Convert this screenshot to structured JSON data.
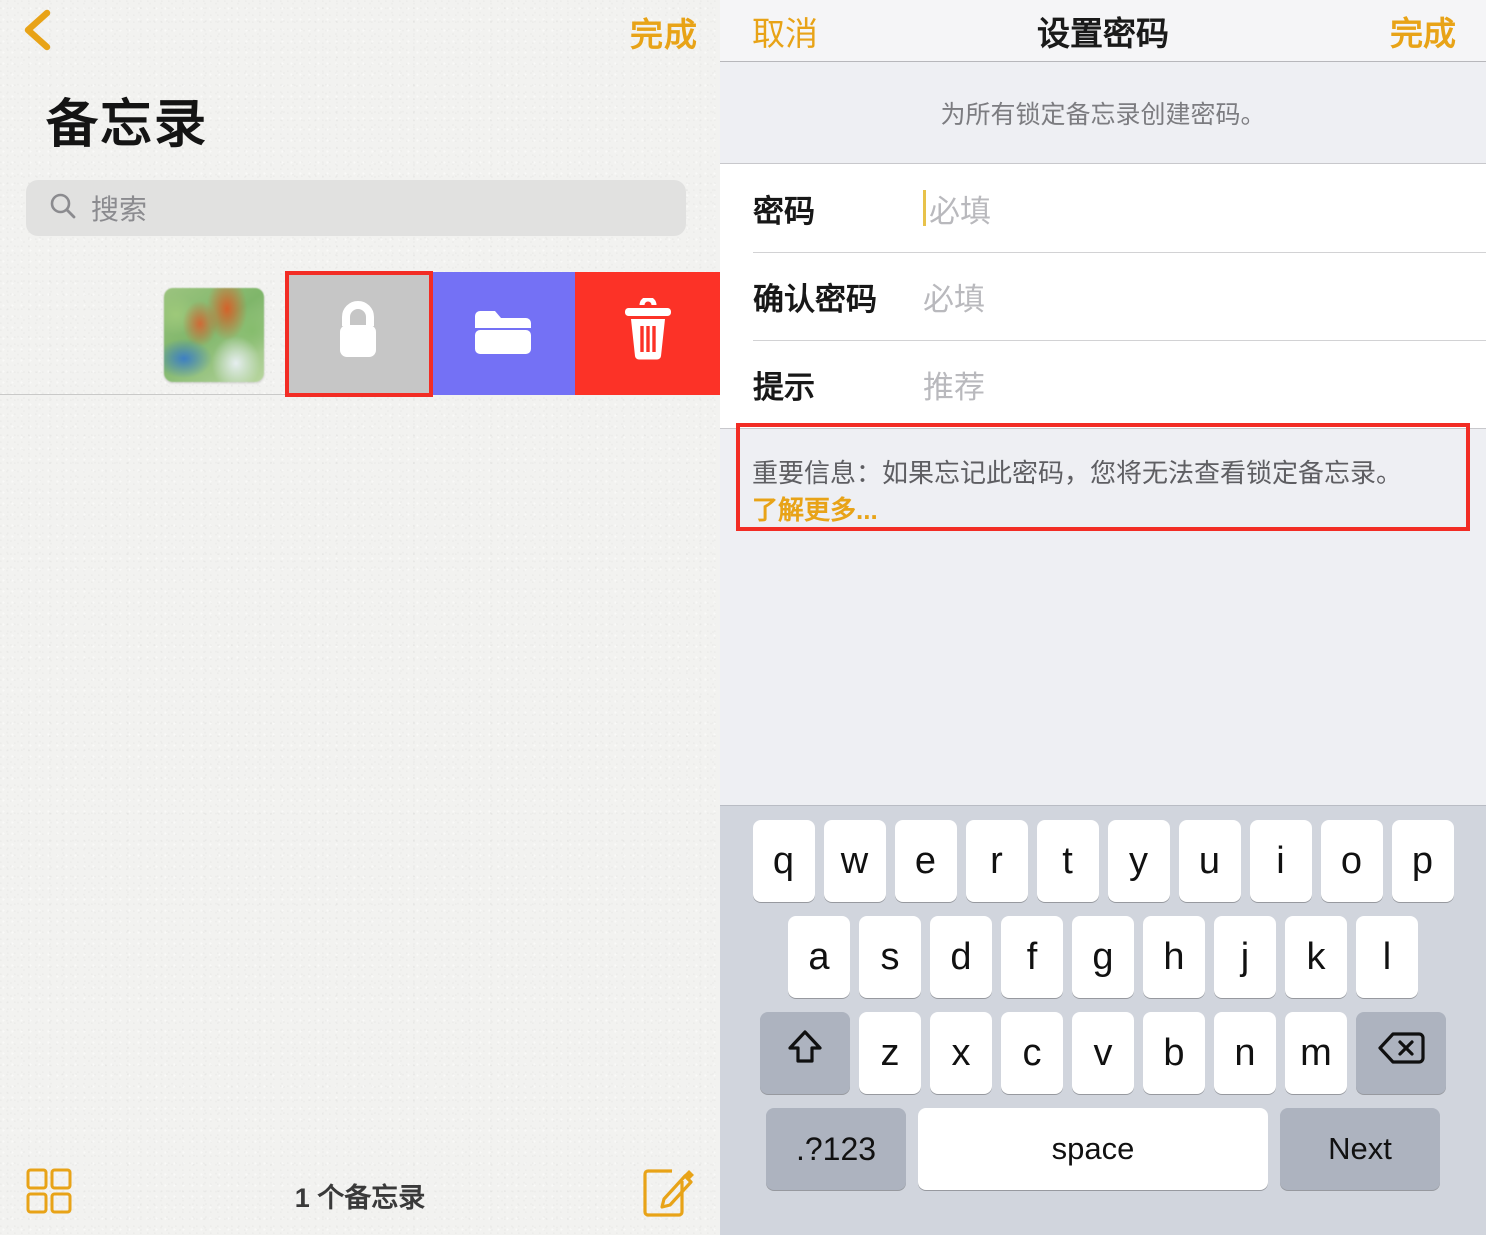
{
  "left_panel": {
    "back_icon": "chevron-left-icon",
    "done_label": "完成",
    "title": "备忘录",
    "search": {
      "icon": "search-icon",
      "placeholder": "搜索",
      "value": ""
    },
    "note_row": {
      "thumbnail": "note-thumbnail-image",
      "swipe_actions": [
        {
          "name": "lock",
          "icon": "lock-icon",
          "color": "#c6c6c6",
          "highlighted": true
        },
        {
          "name": "move-to-folder",
          "icon": "folder-icon",
          "color": "#7471f5",
          "highlighted": false
        },
        {
          "name": "delete",
          "icon": "trash-icon",
          "color": "#fc3227",
          "highlighted": false
        }
      ]
    },
    "toolbar": {
      "grid_icon": "grid-view-icon",
      "count_label": "1 个备忘录",
      "compose_icon": "compose-icon"
    }
  },
  "right_panel": {
    "nav": {
      "cancel_label": "取消",
      "title": "设置密码",
      "done_label": "完成"
    },
    "section_description": "为所有锁定备忘录创建密码。",
    "fields": [
      {
        "label": "密码",
        "placeholder": "必填",
        "value": "",
        "focused": true
      },
      {
        "label": "确认密码",
        "placeholder": "必填",
        "value": "",
        "focused": false
      },
      {
        "label": "提示",
        "placeholder": "推荐",
        "value": "",
        "focused": false
      }
    ],
    "warning": {
      "text": "重要信息：如果忘记此密码，您将无法查看锁定备忘录。",
      "link_label": "了解更多...",
      "highlighted": true
    },
    "keyboard": {
      "row1": [
        "q",
        "w",
        "e",
        "r",
        "t",
        "y",
        "u",
        "i",
        "o",
        "p"
      ],
      "row2": [
        "a",
        "s",
        "d",
        "f",
        "g",
        "h",
        "j",
        "k",
        "l"
      ],
      "row3": [
        "z",
        "x",
        "c",
        "v",
        "b",
        "n",
        "m"
      ],
      "shift_icon": "shift-arrow-icon",
      "backspace_icon": "backspace-icon",
      "numeric_label": ".?123",
      "space_label": "space",
      "next_label": "Next"
    }
  },
  "colors": {
    "accent_orange": "#e8a317",
    "highlight_red": "#f22c24",
    "lock_gray": "#c6c6c6",
    "folder_purple": "#7471f5",
    "trash_red": "#fc3227",
    "keyboard_bg": "#d1d5dd"
  }
}
